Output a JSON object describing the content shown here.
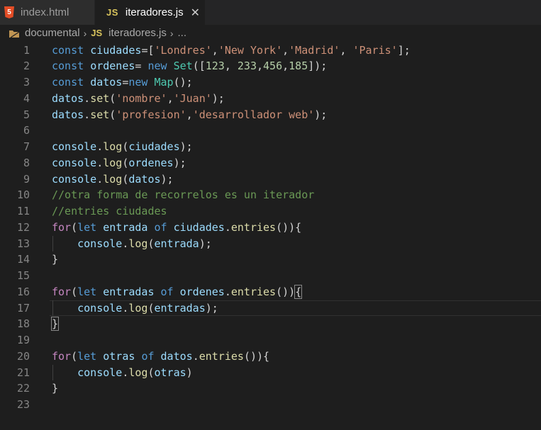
{
  "tabs": [
    {
      "icon": "5",
      "label": "index.html",
      "active": false
    },
    {
      "icon": "JS",
      "label": "iteradores.js",
      "active": true,
      "close": "✕"
    }
  ],
  "breadcrumb": {
    "folder": "documental",
    "file_icon": "JS",
    "file": "iteradores.js",
    "more": "...",
    "separator": "›"
  },
  "colors": {
    "background": "#1e1e1e",
    "keyword": "#569cd6",
    "control": "#c586c0",
    "variable": "#9cdcfe",
    "function": "#dcdcaa",
    "string": "#ce9178",
    "number": "#b5cea8",
    "class": "#4ec9b0",
    "comment": "#6a9955"
  },
  "current_line": 17,
  "lines": [
    {
      "n": "1",
      "tokens": [
        [
          "kw",
          "const"
        ],
        [
          "pl",
          " "
        ],
        [
          "var",
          "ciudades"
        ],
        [
          "pl",
          "=["
        ],
        [
          "str",
          "'Londres'"
        ],
        [
          "pl",
          ","
        ],
        [
          "str",
          "'New York'"
        ],
        [
          "pl",
          ","
        ],
        [
          "str",
          "'Madrid'"
        ],
        [
          "pl",
          ", "
        ],
        [
          "str",
          "'Paris'"
        ],
        [
          "pl",
          "];"
        ]
      ]
    },
    {
      "n": "2",
      "tokens": [
        [
          "kw",
          "const"
        ],
        [
          "pl",
          " "
        ],
        [
          "var",
          "ordenes"
        ],
        [
          "pl",
          "= "
        ],
        [
          "kw",
          "new"
        ],
        [
          "pl",
          " "
        ],
        [
          "cls",
          "Set"
        ],
        [
          "pl",
          "(["
        ],
        [
          "num",
          "123"
        ],
        [
          "pl",
          ", "
        ],
        [
          "num",
          "233"
        ],
        [
          "pl",
          ","
        ],
        [
          "num",
          "456"
        ],
        [
          "pl",
          ","
        ],
        [
          "num",
          "185"
        ],
        [
          "pl",
          "]);"
        ]
      ]
    },
    {
      "n": "3",
      "tokens": [
        [
          "kw",
          "const"
        ],
        [
          "pl",
          " "
        ],
        [
          "var",
          "datos"
        ],
        [
          "pl",
          "="
        ],
        [
          "kw",
          "new"
        ],
        [
          "pl",
          " "
        ],
        [
          "cls",
          "Map"
        ],
        [
          "pl",
          "();"
        ]
      ]
    },
    {
      "n": "4",
      "tokens": [
        [
          "var",
          "datos"
        ],
        [
          "pl",
          "."
        ],
        [
          "fn",
          "set"
        ],
        [
          "pl",
          "("
        ],
        [
          "str",
          "'nombre'"
        ],
        [
          "pl",
          ","
        ],
        [
          "str",
          "'Juan'"
        ],
        [
          "pl",
          ");"
        ]
      ]
    },
    {
      "n": "5",
      "tokens": [
        [
          "var",
          "datos"
        ],
        [
          "pl",
          "."
        ],
        [
          "fn",
          "set"
        ],
        [
          "pl",
          "("
        ],
        [
          "str",
          "'profesion'"
        ],
        [
          "pl",
          ","
        ],
        [
          "str",
          "'desarrollador web'"
        ],
        [
          "pl",
          ");"
        ]
      ]
    },
    {
      "n": "6",
      "tokens": []
    },
    {
      "n": "7",
      "tokens": [
        [
          "var",
          "console"
        ],
        [
          "pl",
          "."
        ],
        [
          "fn",
          "log"
        ],
        [
          "pl",
          "("
        ],
        [
          "var",
          "ciudades"
        ],
        [
          "pl",
          ");"
        ]
      ]
    },
    {
      "n": "8",
      "tokens": [
        [
          "var",
          "console"
        ],
        [
          "pl",
          "."
        ],
        [
          "fn",
          "log"
        ],
        [
          "pl",
          "("
        ],
        [
          "var",
          "ordenes"
        ],
        [
          "pl",
          ");"
        ]
      ]
    },
    {
      "n": "9",
      "tokens": [
        [
          "var",
          "console"
        ],
        [
          "pl",
          "."
        ],
        [
          "fn",
          "log"
        ],
        [
          "pl",
          "("
        ],
        [
          "var",
          "datos"
        ],
        [
          "pl",
          ");"
        ]
      ]
    },
    {
      "n": "10",
      "tokens": [
        [
          "cm",
          "//otra forma de recorrelos es un iterador"
        ]
      ]
    },
    {
      "n": "11",
      "tokens": [
        [
          "cm",
          "//entries ciudades"
        ]
      ]
    },
    {
      "n": "12",
      "tokens": [
        [
          "ctl",
          "for"
        ],
        [
          "pl",
          "("
        ],
        [
          "kw",
          "let"
        ],
        [
          "pl",
          " "
        ],
        [
          "var",
          "entrada"
        ],
        [
          "pl",
          " "
        ],
        [
          "kw",
          "of"
        ],
        [
          "pl",
          " "
        ],
        [
          "var",
          "ciudades"
        ],
        [
          "pl",
          "."
        ],
        [
          "fn",
          "entries"
        ],
        [
          "pl",
          "()){"
        ]
      ]
    },
    {
      "n": "13",
      "tokens": [
        [
          "pl",
          "    "
        ],
        [
          "var",
          "console"
        ],
        [
          "pl",
          "."
        ],
        [
          "fn",
          "log"
        ],
        [
          "pl",
          "("
        ],
        [
          "var",
          "entrada"
        ],
        [
          "pl",
          ");"
        ]
      ]
    },
    {
      "n": "14",
      "tokens": [
        [
          "pl",
          "}"
        ]
      ]
    },
    {
      "n": "15",
      "tokens": []
    },
    {
      "n": "16",
      "tokens": [
        [
          "ctl",
          "for"
        ],
        [
          "pl",
          "("
        ],
        [
          "kw",
          "let"
        ],
        [
          "pl",
          " "
        ],
        [
          "var",
          "entradas"
        ],
        [
          "pl",
          " "
        ],
        [
          "kw",
          "of"
        ],
        [
          "pl",
          " "
        ],
        [
          "var",
          "ordenes"
        ],
        [
          "pl",
          "."
        ],
        [
          "fn",
          "entries"
        ],
        [
          "pl",
          "())"
        ],
        [
          "box",
          "{"
        ]
      ]
    },
    {
      "n": "17",
      "tokens": [
        [
          "pl",
          "    "
        ],
        [
          "var",
          "console"
        ],
        [
          "pl",
          "."
        ],
        [
          "fn",
          "log"
        ],
        [
          "pl",
          "("
        ],
        [
          "var",
          "entradas"
        ],
        [
          "pl",
          ");"
        ]
      ]
    },
    {
      "n": "18",
      "tokens": [
        [
          "box",
          "}"
        ]
      ]
    },
    {
      "n": "19",
      "tokens": []
    },
    {
      "n": "20",
      "tokens": [
        [
          "ctl",
          "for"
        ],
        [
          "pl",
          "("
        ],
        [
          "kw",
          "let"
        ],
        [
          "pl",
          " "
        ],
        [
          "var",
          "otras"
        ],
        [
          "pl",
          " "
        ],
        [
          "kw",
          "of"
        ],
        [
          "pl",
          " "
        ],
        [
          "var",
          "datos"
        ],
        [
          "pl",
          "."
        ],
        [
          "fn",
          "entries"
        ],
        [
          "pl",
          "()){"
        ]
      ]
    },
    {
      "n": "21",
      "tokens": [
        [
          "pl",
          "    "
        ],
        [
          "var",
          "console"
        ],
        [
          "pl",
          "."
        ],
        [
          "fn",
          "log"
        ],
        [
          "pl",
          "("
        ],
        [
          "var",
          "otras"
        ],
        [
          "pl",
          ")"
        ]
      ]
    },
    {
      "n": "22",
      "tokens": [
        [
          "pl",
          "}"
        ]
      ]
    },
    {
      "n": "23",
      "tokens": []
    }
  ]
}
